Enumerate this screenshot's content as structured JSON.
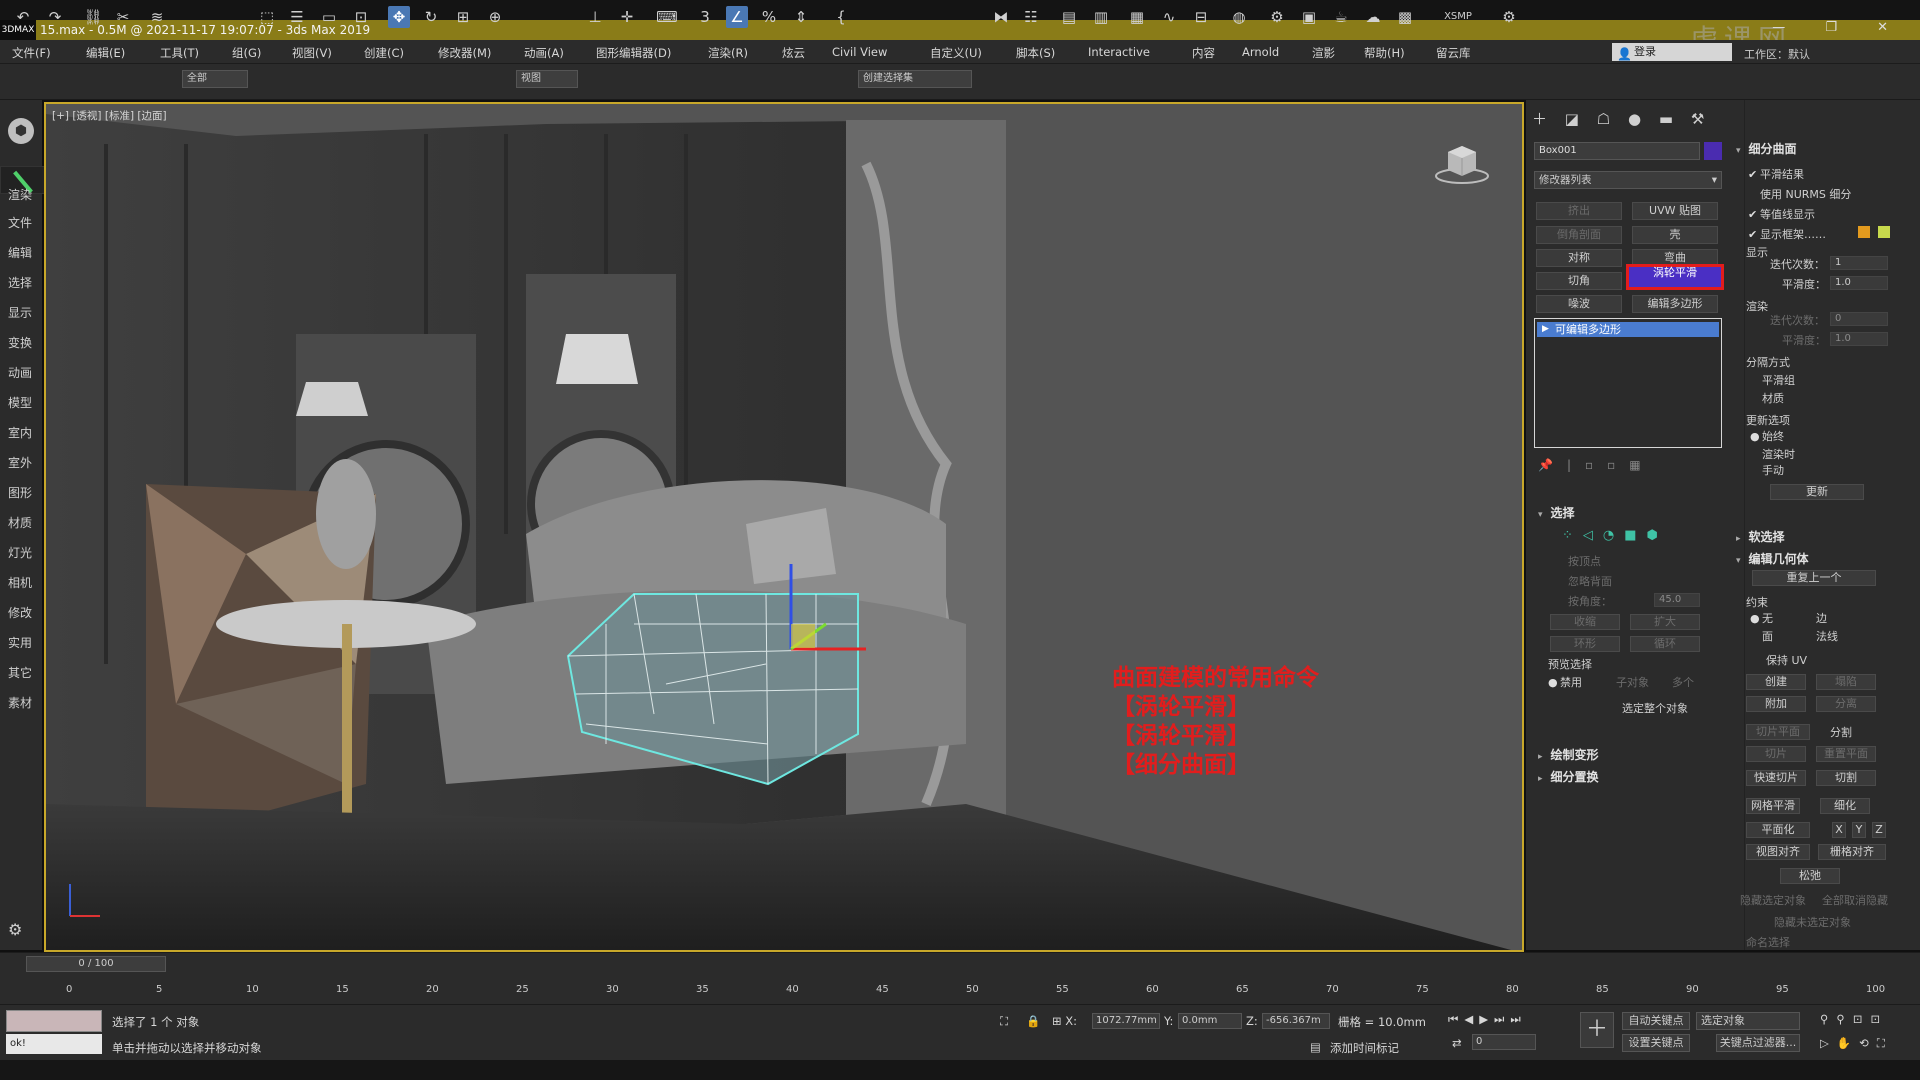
{
  "title": {
    "logo": "3DMAX",
    "text": "15.max - 0.5M @ 2021-11-17 19:07:07 - 3ds Max 2019",
    "watermark": "虎课网",
    "controls": "— ❐ ✕"
  },
  "menu": [
    "文件(F)",
    "编辑(E)",
    "工具(T)",
    "组(G)",
    "视图(V)",
    "创建(C)",
    "修改器(M)",
    "动画(A)",
    "图形编辑器(D)",
    "渲染(R)",
    "炫云",
    "Civil View",
    "自定义(U)",
    "脚本(S)",
    "Interactive",
    "内容",
    "Arnold",
    "渲影",
    "帮助(H)",
    "留云库"
  ],
  "login": "登录",
  "workspace": "工作区：默认",
  "toolbar": {
    "filter": "全部",
    "view": "视图",
    "selset": "创建选择集",
    "xsmp": "XSMP"
  },
  "left_tabs": [
    "渲染",
    "文件",
    "编辑",
    "选择",
    "显示",
    "变换",
    "动画",
    "模型",
    "室内",
    "室外",
    "图形",
    "材质",
    "灯光",
    "相机",
    "修改",
    "实用",
    "其它",
    "素材"
  ],
  "viewport": {
    "label": "[+] [透视] [标准] [边面]",
    "annotation": [
      "曲面建模的常用命令",
      "【涡轮平滑】",
      "【涡轮平滑】",
      "【细分曲面】"
    ]
  },
  "command": {
    "object_name": "Box001",
    "object_color": "#4a2cb0",
    "modifier_list": "修改器列表",
    "buttons": [
      "挤出",
      "UVW 贴图",
      "倒角剖面",
      "壳",
      "对称",
      "弯曲",
      "切角",
      "涡轮平滑",
      "噪波",
      "编辑多边形"
    ],
    "stack_item": "可编辑多边形"
  },
  "select": {
    "title": "选择",
    "by_vertex": "按顶点",
    "ignore_back": "忽略背面",
    "by_angle": "按角度：",
    "angle": "45.0",
    "shrink": "收缩",
    "grow": "扩大",
    "ring": "环形",
    "loop": "循环",
    "preview": "预览选择",
    "disable": "禁用",
    "sub": "子对象",
    "multi": "多个",
    "select_whole": "选定整个对象",
    "paint": "绘制变形",
    "subdiv_disp": "细分置换"
  },
  "subdiv": {
    "title": "细分曲面",
    "smooth_result": "平滑结果",
    "use_nurms": "使用 NURMS 细分",
    "isoline": "等值线显示",
    "show_cage": "显示框架……",
    "display": "显示",
    "iterations": "迭代次数：",
    "iter_val": "1",
    "smoothness": "平滑度：",
    "smooth_val": "1.0",
    "render": "渲染",
    "r_iter_val": "0",
    "r_smooth_val": "1.0",
    "sep": "分隔方式",
    "smooth_grp": "平滑组",
    "material": "材质",
    "update_opts": "更新选项",
    "always": "始终",
    "when_render": "渲染时",
    "manual": "手动",
    "update": "更新",
    "soft_sel": "软选择",
    "edit_geo": "编辑几何体",
    "repeat": "重复上一个",
    "constraint": "约束",
    "none": "无",
    "edge": "边",
    "face": "面",
    "normal": "法线",
    "keep_uv": "保持 UV",
    "create": "创建",
    "collapse": "塌陷",
    "attach": "附加",
    "detach": "分离",
    "slice_plane": "切片平面",
    "split": "分割",
    "slice": "切片",
    "reset_plane": "重置平面",
    "quickslice": "快速切片",
    "cut": "切割",
    "meshsmooth": "网格平滑",
    "tessellate": "细化",
    "planar": "平面化",
    "x": "X",
    "y": "Y",
    "z": "Z",
    "view_align": "视图对齐",
    "grid_align": "栅格对齐",
    "relax": "松弛",
    "hide_sel": "隐藏选定对象",
    "unhide_all": "全部取消隐藏",
    "hide_unsel": "隐藏未选定对象",
    "named_sel": "命名选择"
  },
  "timeline": {
    "slider": "0 / 100",
    "ticks": [
      "0",
      "5",
      "10",
      "15",
      "20",
      "25",
      "30",
      "35",
      "40",
      "45",
      "50",
      "55",
      "60",
      "65",
      "70",
      "75",
      "80",
      "85",
      "90",
      "95",
      "100"
    ]
  },
  "status": {
    "mx": "ok!",
    "selected": "选择了 1 个 对象",
    "hint": "单击并拖动以选择并移动对象",
    "x": "1072.77mm",
    "y": "0.0mm",
    "z": "-656.367m",
    "grid": "栅格 = 10.0mm",
    "addtime": "添加时间标记",
    "autokey": "自动关键点",
    "selobj": "选定对象",
    "setkey": "设置关键点",
    "keyfilter": "关键点过滤器...",
    "frame": "0"
  }
}
